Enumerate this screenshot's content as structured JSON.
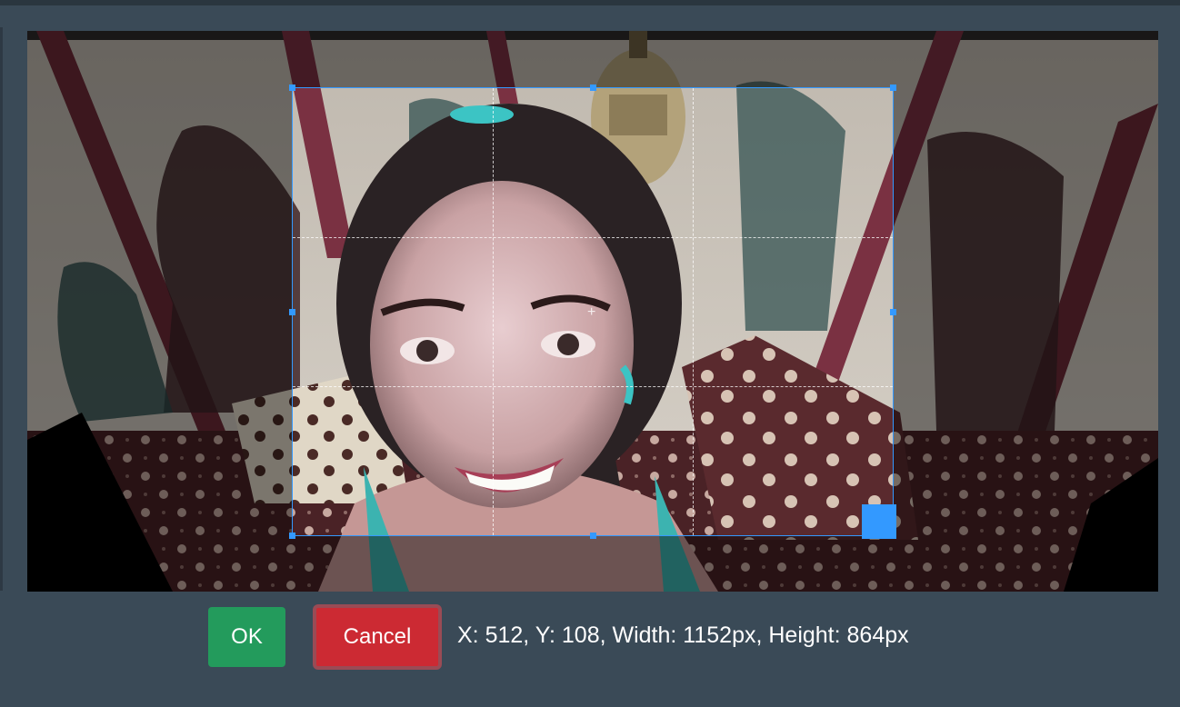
{
  "dialog": {
    "ok_label": "OK",
    "cancel_label": "Cancel",
    "crop_readout": "X: 512, Y: 108, Width: 1152px, Height: 864px"
  },
  "image": {
    "description_icon": "photo-preview"
  },
  "colors": {
    "background": "#3a4a57",
    "ok_button": "#239b5c",
    "cancel_button": "#cc2a33",
    "crop_accent": "#3399ff"
  },
  "icons": {
    "center": "crosshair-icon",
    "resize": "resize-handle-icon"
  }
}
